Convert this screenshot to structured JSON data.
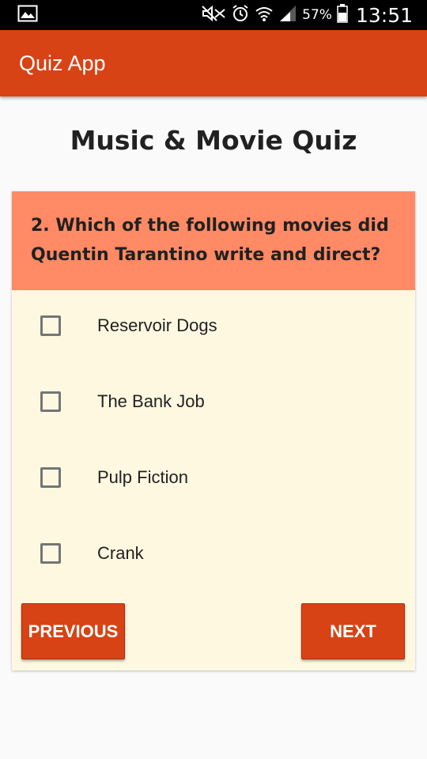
{
  "status_bar": {
    "icons": [
      "image-icon",
      "mute-icon",
      "alarm-icon",
      "wifi-icon",
      "signal-icon",
      "battery-icon"
    ],
    "battery": "57%",
    "time": "13:51"
  },
  "app_bar": {
    "title": "Quiz App",
    "color": "#d84315"
  },
  "quiz": {
    "heading": "Music & Movie Quiz",
    "question": {
      "line1": "2. Which of the following movies did",
      "line2": "Quentin Tarantino write and direct?"
    },
    "options": [
      {
        "label": "Reservoir Dogs",
        "checked": false
      },
      {
        "label": "The Bank Job",
        "checked": false
      },
      {
        "label": "Pulp Fiction",
        "checked": false
      },
      {
        "label": "Crank",
        "checked": false
      }
    ],
    "previous_label": "PREVIOUS",
    "next_label": "NEXT"
  },
  "colors": {
    "accent": "#d84315",
    "question_bg": "#ff8a65",
    "card_bg": "#fff8e1"
  }
}
